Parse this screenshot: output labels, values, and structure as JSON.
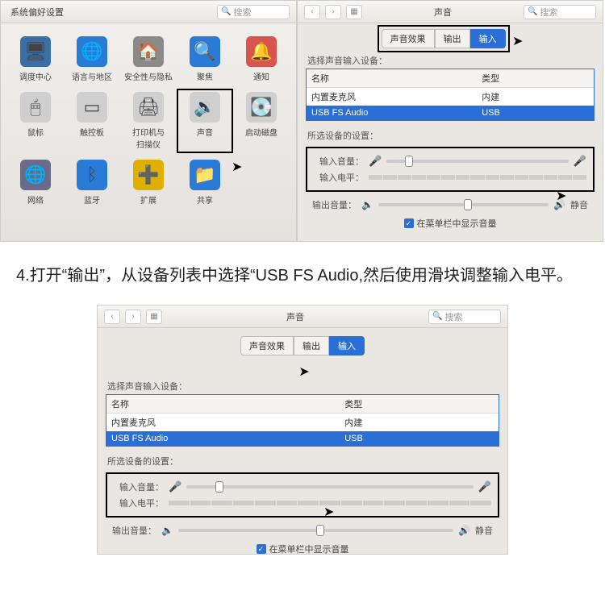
{
  "sysprefs": {
    "title": "系统偏好设置",
    "search_placeholder": "搜索",
    "items": [
      {
        "label": "调度中心",
        "glyph": "🖥",
        "bg": "#3b6ea5",
        "id": "mission-control"
      },
      {
        "label": "语言与地区",
        "glyph": "🌐",
        "bg": "#2a7bd6",
        "id": "language-region"
      },
      {
        "label": "安全性与隐私",
        "glyph": "🏠",
        "bg": "#8a8a8a",
        "id": "security-privacy"
      },
      {
        "label": "聚焦",
        "glyph": "🔍",
        "bg": "#2a7bd6",
        "id": "spotlight"
      },
      {
        "label": "通知",
        "glyph": "🔔",
        "bg": "#d9534f",
        "id": "notifications"
      },
      {
        "label": "鼠标",
        "glyph": "🖱",
        "bg": "#cfcfcf",
        "id": "mouse"
      },
      {
        "label": "触控板",
        "glyph": "▭",
        "bg": "#cfcfcf",
        "id": "trackpad"
      },
      {
        "label": "打印机与\n扫描仪",
        "glyph": "🖨",
        "bg": "#cfcfcf",
        "id": "printers-scanners"
      },
      {
        "label": "声音",
        "glyph": "🔉",
        "bg": "#cfcfcf",
        "id": "sound",
        "highlighted": true
      },
      {
        "label": "启动磁盘",
        "glyph": "💽",
        "bg": "#cfcfcf",
        "id": "startup-disk"
      },
      {
        "label": "网络",
        "glyph": "🌐",
        "bg": "#6a6a8a",
        "id": "network"
      },
      {
        "label": "蓝牙",
        "glyph": "ᛒ",
        "bg": "#2a7bd6",
        "id": "bluetooth"
      },
      {
        "label": "扩展",
        "glyph": "➕",
        "bg": "#e0b000",
        "id": "extensions"
      },
      {
        "label": "共享",
        "glyph": "📁",
        "bg": "#2a7bd6",
        "id": "sharing"
      }
    ]
  },
  "sound": {
    "window_title": "声音",
    "search_placeholder": "搜索",
    "tabs": {
      "effects": "声音效果",
      "output": "输出",
      "input": "输入"
    },
    "choose_label": "选择声音输入设备：",
    "col_name": "名称",
    "col_type": "类型",
    "devices": [
      {
        "name": "内置麦克风",
        "type": "内建",
        "selected": false
      },
      {
        "name": "USB FS Audio",
        "type": "USB",
        "selected": true
      }
    ],
    "selected_settings_label": "所选设备的设置：",
    "input_volume_label": "输入音量：",
    "input_level_label": "输入电平：",
    "output_volume_label": "输出音量：",
    "mute_label": "静音",
    "menubar_checkbox_label": "在菜单栏中显示音量"
  },
  "instruction_text": "4.打开“输出”，从设备列表中选择“USB FS Audio,然后使用滑块调整输入电平。"
}
